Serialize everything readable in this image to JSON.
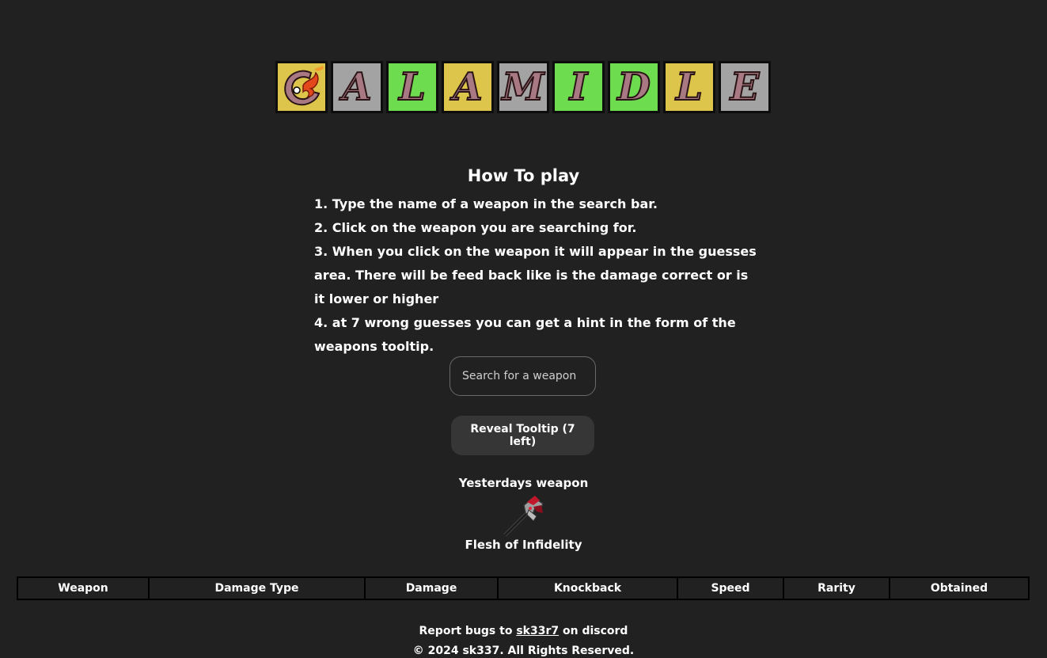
{
  "logo": {
    "tiles": [
      {
        "letter": "C",
        "color": "#dcc54a",
        "icon": "flame-c-icon"
      },
      {
        "letter": "A",
        "color": "#a3a3a3"
      },
      {
        "letter": "L",
        "color": "#6ddc4f"
      },
      {
        "letter": "A",
        "color": "#dcc54a"
      },
      {
        "letter": "M",
        "color": "#a3a3a3"
      },
      {
        "letter": "I",
        "color": "#6ddc4f"
      },
      {
        "letter": "D",
        "color": "#6ddc4f"
      },
      {
        "letter": "L",
        "color": "#dcc54a"
      },
      {
        "letter": "E",
        "color": "#a3a3a3"
      }
    ]
  },
  "howto": {
    "title": "How To play",
    "steps": [
      "1. Type the name of a weapon in the search bar.",
      "2. Click on the weapon you are searching for.",
      "3. When you click on the weapon it will appear in the guesses area. There will be feed back like is the damage correct or is it lower or higher",
      "4. at 7 wrong guesses you can get a hint in the form of the weapons tooltip."
    ]
  },
  "search": {
    "placeholder": "Search for a weapon"
  },
  "reveal_button": "Reveal Tooltip (7 left)",
  "yesterday": {
    "label": "Yesterdays weapon",
    "name": "Flesh of Infidelity",
    "icon": "axe-weapon-icon"
  },
  "table": {
    "headers": [
      "Weapon",
      "Damage Type",
      "Damage",
      "Knockback",
      "Speed",
      "Rarity",
      "Obtained"
    ]
  },
  "footer": {
    "prefix": "Report bugs to",
    "link": "sk33r7",
    "suffix": "on discord",
    "copyright": "© 2024 sk337. All Rights Reserved."
  },
  "colors": {
    "background": "#212121",
    "correct": "#6ddc4f",
    "partial": "#dcc54a",
    "wrong": "#a3a3a3",
    "button": "#363636"
  }
}
